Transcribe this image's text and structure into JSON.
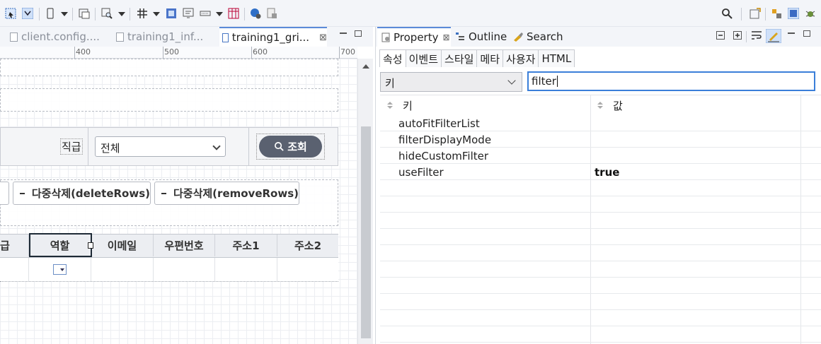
{
  "editor": {
    "tabs": [
      {
        "label": "client.config...."
      },
      {
        "label": "training1_inf..."
      },
      {
        "label": "training1_gri...",
        "close": "⊠"
      }
    ],
    "ruler": [
      "400",
      "500",
      "600",
      "700"
    ],
    "search_area": {
      "grade_label": "직급",
      "grade_select_value": "전체",
      "search_button": "조회"
    },
    "buttons": {
      "delete_rows": "다중삭제(deleteRows)",
      "remove_rows": "다중삭제(removeRows)"
    },
    "grid_columns": [
      "급",
      "역할",
      "이메일",
      "우편번호",
      "주소1",
      "주소2"
    ]
  },
  "panel": {
    "tabs": {
      "property": "Property",
      "property_close": "⊠",
      "outline": "Outline",
      "search": "Search"
    },
    "subtabs": [
      "속성",
      "이벤트",
      "스타일",
      "메타",
      "사용자",
      "HTML"
    ],
    "key_select_value": "키",
    "filter_input_value": "filter",
    "table_headers": {
      "key": "키",
      "value": "값"
    },
    "rows": [
      {
        "key": "autoFitFilterList",
        "value": ""
      },
      {
        "key": "filterDisplayMode",
        "value": ""
      },
      {
        "key": "hideCustomFilter",
        "value": ""
      },
      {
        "key": "useFilter",
        "value": "true"
      }
    ]
  },
  "colors": {
    "accent": "#3b7fd9",
    "search_button_bg": "#5a6170",
    "toolbar_bg": "#f3f5f9"
  }
}
